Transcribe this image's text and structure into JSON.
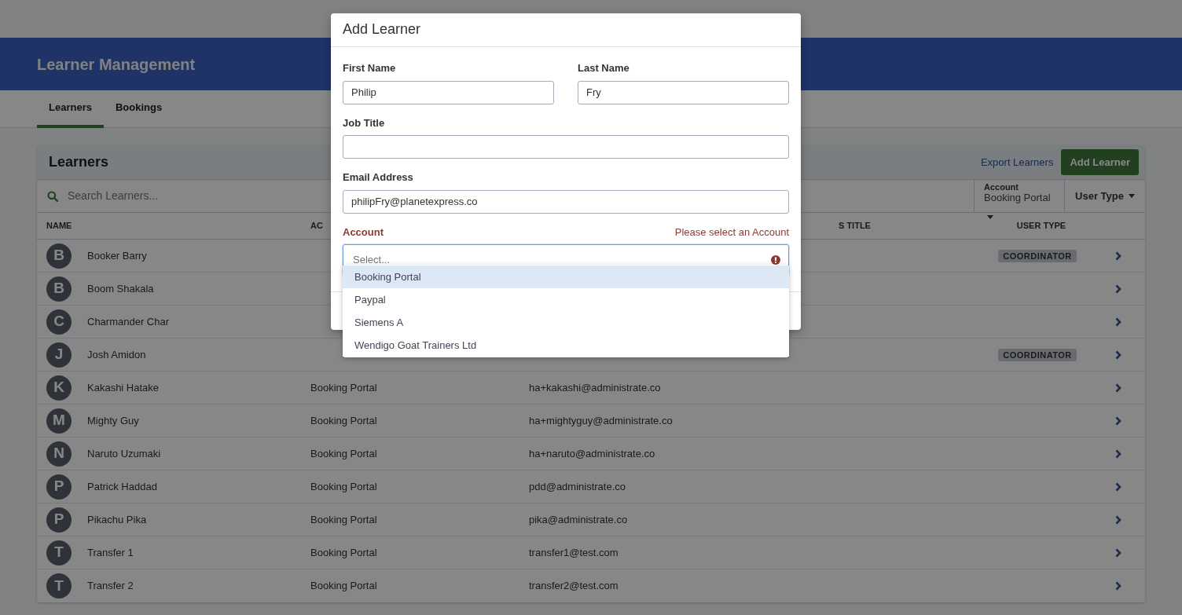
{
  "header": {
    "title": "Learner Management"
  },
  "tabs": [
    {
      "label": "Learners",
      "selected": true
    },
    {
      "label": "Bookings",
      "selected": false
    }
  ],
  "card": {
    "title": "Learners",
    "export_link": "Export Learners",
    "add_button": "Add Learner"
  },
  "filters": {
    "search_placeholder": "Search Learners...",
    "account_label": "Account",
    "account_value": "Booking Portal",
    "user_type": "User Type"
  },
  "table": {
    "columns": [
      "NAME",
      "AC",
      "S TITLE",
      "USER TYPE"
    ],
    "rows": [
      {
        "initial": "B",
        "name": "Booker Barry",
        "user_type": "COORDINATOR"
      },
      {
        "initial": "B",
        "name": "Boom Shakala"
      },
      {
        "initial": "C",
        "name": "Charmander Char"
      },
      {
        "initial": "J",
        "name": "Josh Amidon",
        "user_type": "COORDINATOR"
      },
      {
        "initial": "K",
        "name": "Kakashi Hatake",
        "account": "Booking Portal",
        "email": "ha+kakashi@administrate.co"
      },
      {
        "initial": "M",
        "name": "Mighty Guy",
        "account": "Booking Portal",
        "email": "ha+mightyguy@administrate.co"
      },
      {
        "initial": "N",
        "name": "Naruto Uzumaki",
        "account": "Booking Portal",
        "email": "ha+naruto@administrate.co"
      },
      {
        "initial": "P",
        "name": "Patrick Haddad",
        "account": "Booking Portal",
        "email": "pdd@administrate.co"
      },
      {
        "initial": "P",
        "name": "Pikachu Pika",
        "account": "Booking Portal",
        "email": "pika@administrate.co"
      },
      {
        "initial": "T",
        "name": "Transfer 1",
        "account": "Booking Portal",
        "email": "transfer1@test.com"
      },
      {
        "initial": "T",
        "name": "Transfer 2",
        "account": "Booking Portal",
        "email": "transfer2@test.com"
      }
    ]
  },
  "modal": {
    "title": "Add Learner",
    "fields": [
      {
        "label": "First Name",
        "value": "Philip",
        "half": true
      },
      {
        "label": "Last Name",
        "value": "Fry",
        "half": true
      },
      {
        "label": "Job Title",
        "half": false
      },
      {
        "label": "Email Address",
        "value": "philipFry@planetexpress.co",
        "half": false
      },
      {
        "label": "Account",
        "placeholder": "Select...",
        "half": false,
        "error": "Please select an Account",
        "kind": "select"
      }
    ],
    "options": [
      {
        "label": "Booking Portal",
        "selected": true
      },
      {
        "label": "Paypal",
        "selected": false
      },
      {
        "label": "Siemens A",
        "selected": false
      },
      {
        "label": "Wendigo Goat Trainers Ltd",
        "selected": false
      }
    ]
  }
}
